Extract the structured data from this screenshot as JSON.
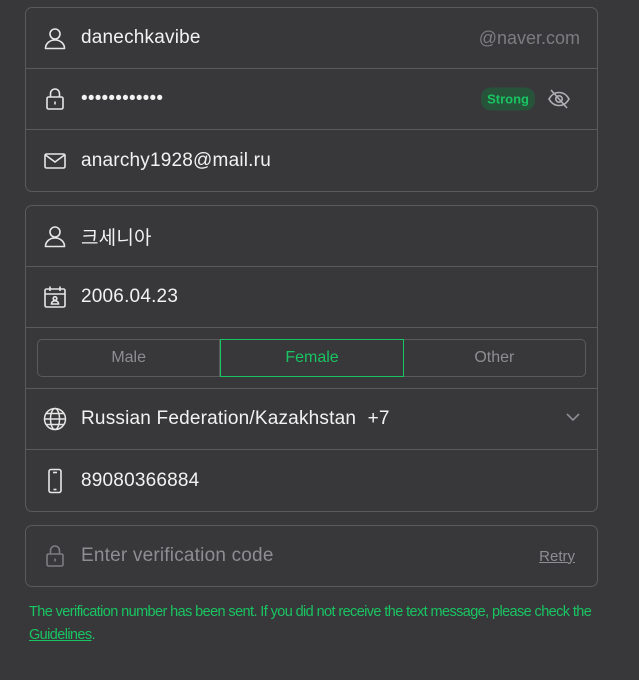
{
  "account": {
    "username": "danechkavibe",
    "domain_suffix": "@naver.com",
    "password_masked": "••••••••••••",
    "strength_badge": "Strong",
    "email": "anarchy1928@mail.ru"
  },
  "profile": {
    "name": "크세니아",
    "birthdate": "2006.04.23",
    "gender_options": [
      "Male",
      "Female",
      "Other"
    ],
    "gender_selected": "Female",
    "country": "Russian Federation/Kazakhstan",
    "country_code": "+7",
    "phone": "89080366884"
  },
  "verification": {
    "placeholder": "Enter verification code",
    "retry_label": "Retry"
  },
  "notice": {
    "text": "The verification number has been sent. If you did not receive the text message, please check the ",
    "link_label": "Guidelines",
    "end": "."
  },
  "colors": {
    "background": "#38383a",
    "border": "#5a5a5d",
    "accent": "#19c462",
    "text": "#f2f2f2",
    "muted": "#8e8e92"
  },
  "icons": [
    "user-icon",
    "lock-icon",
    "eye-off-icon",
    "mail-icon",
    "calendar-icon",
    "globe-icon",
    "phone-icon",
    "chevron-down-icon"
  ]
}
